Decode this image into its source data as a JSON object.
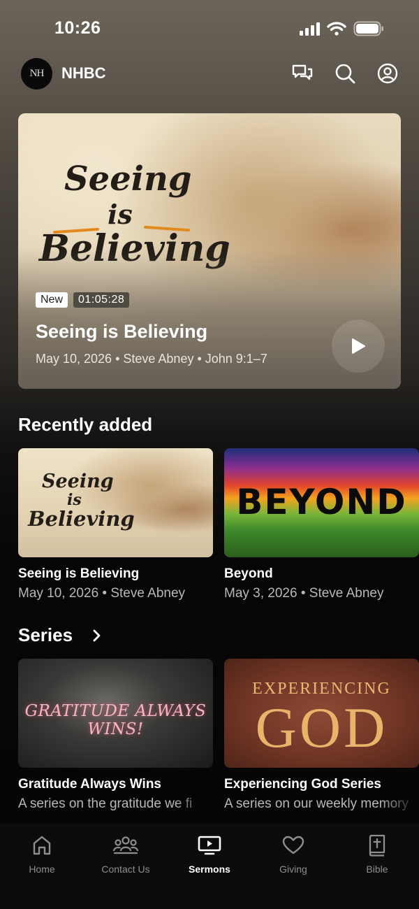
{
  "status_bar": {
    "time": "10:26"
  },
  "header": {
    "logo_text": "NH",
    "app_name": "NHBC",
    "icons": [
      "chat-icon",
      "search-icon",
      "profile-icon"
    ]
  },
  "hero": {
    "art_title": {
      "line1": "Seeing",
      "line2": "is",
      "line3": "Believing"
    },
    "badge_new": "New",
    "duration": "01:05:28",
    "title": "Seeing is Believing",
    "meta": "May 10, 2026 • Steve Abney • John 9:1–7"
  },
  "recently_added": {
    "heading": "Recently added",
    "items": [
      {
        "art": {
          "line1": "Seeing",
          "line2": "is",
          "line3": "Believing"
        },
        "title": "Seeing is Believing",
        "subtitle": "May 10, 2026 • Steve Abney"
      },
      {
        "art": {
          "line1": "BEYOND"
        },
        "title": "Beyond",
        "subtitle": "May 3, 2026 • Steve Abney"
      }
    ]
  },
  "series": {
    "heading": "Series",
    "items": [
      {
        "art": {
          "line1": "GRATITUDE ALWAYS WINS!"
        },
        "title": "Gratitude Always Wins",
        "subtitle": "A series on the gratitude we fi"
      },
      {
        "art": {
          "line1": "EXPERIENCING",
          "line2": "GOD"
        },
        "title": "Experiencing God Series",
        "subtitle": "A series on our weekly memory"
      }
    ]
  },
  "tabbar": {
    "tabs": [
      {
        "label": "Home",
        "icon": "home-icon",
        "active": false
      },
      {
        "label": "Contact Us",
        "icon": "people-icon",
        "active": false
      },
      {
        "label": "Sermons",
        "icon": "tv-play-icon",
        "active": true
      },
      {
        "label": "Giving",
        "icon": "heart-icon",
        "active": false
      },
      {
        "label": "Bible",
        "icon": "bible-icon",
        "active": false
      }
    ]
  }
}
